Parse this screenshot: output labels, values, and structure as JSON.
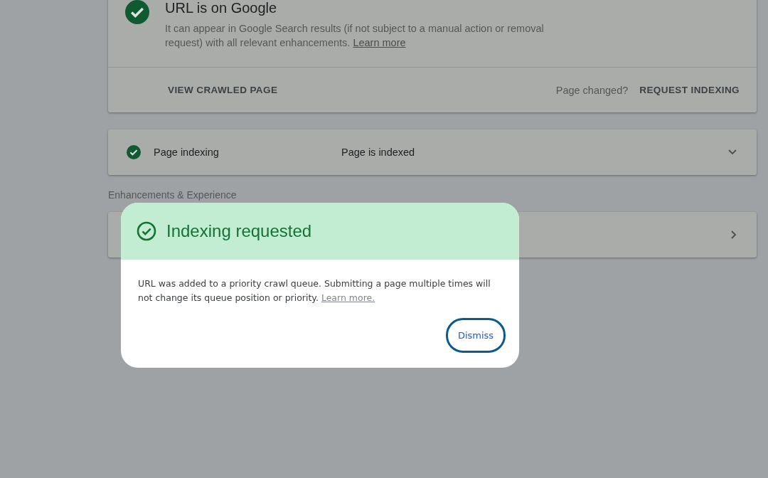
{
  "status_card": {
    "title": "URL is on Google",
    "description": "It can appear in Google Search results (if not subject to a manual action or removal request) with all relevant enhancements.",
    "link": "Learn more",
    "actions": [
      {
        "label": "VIEW CRAWLED PAGE",
        "kind": "button"
      },
      {
        "label": "Page changed?",
        "kind": "prompt"
      },
      {
        "label": "REQUEST INDEXING",
        "kind": "button"
      }
    ]
  },
  "rows": [
    {
      "kind": "expandable",
      "label": "Page indexing",
      "value": "Page is indexed"
    },
    {
      "kind": "heading",
      "label": "Enhancements & Experience"
    },
    {
      "kind": "link-row"
    }
  ],
  "dialog": {
    "title": "Indexing requested",
    "message": "URL was added to a priority crawl queue. Submitting a page multiple times will not change its queue position or priority.",
    "link": "Learn more.",
    "button": "Dismiss"
  }
}
